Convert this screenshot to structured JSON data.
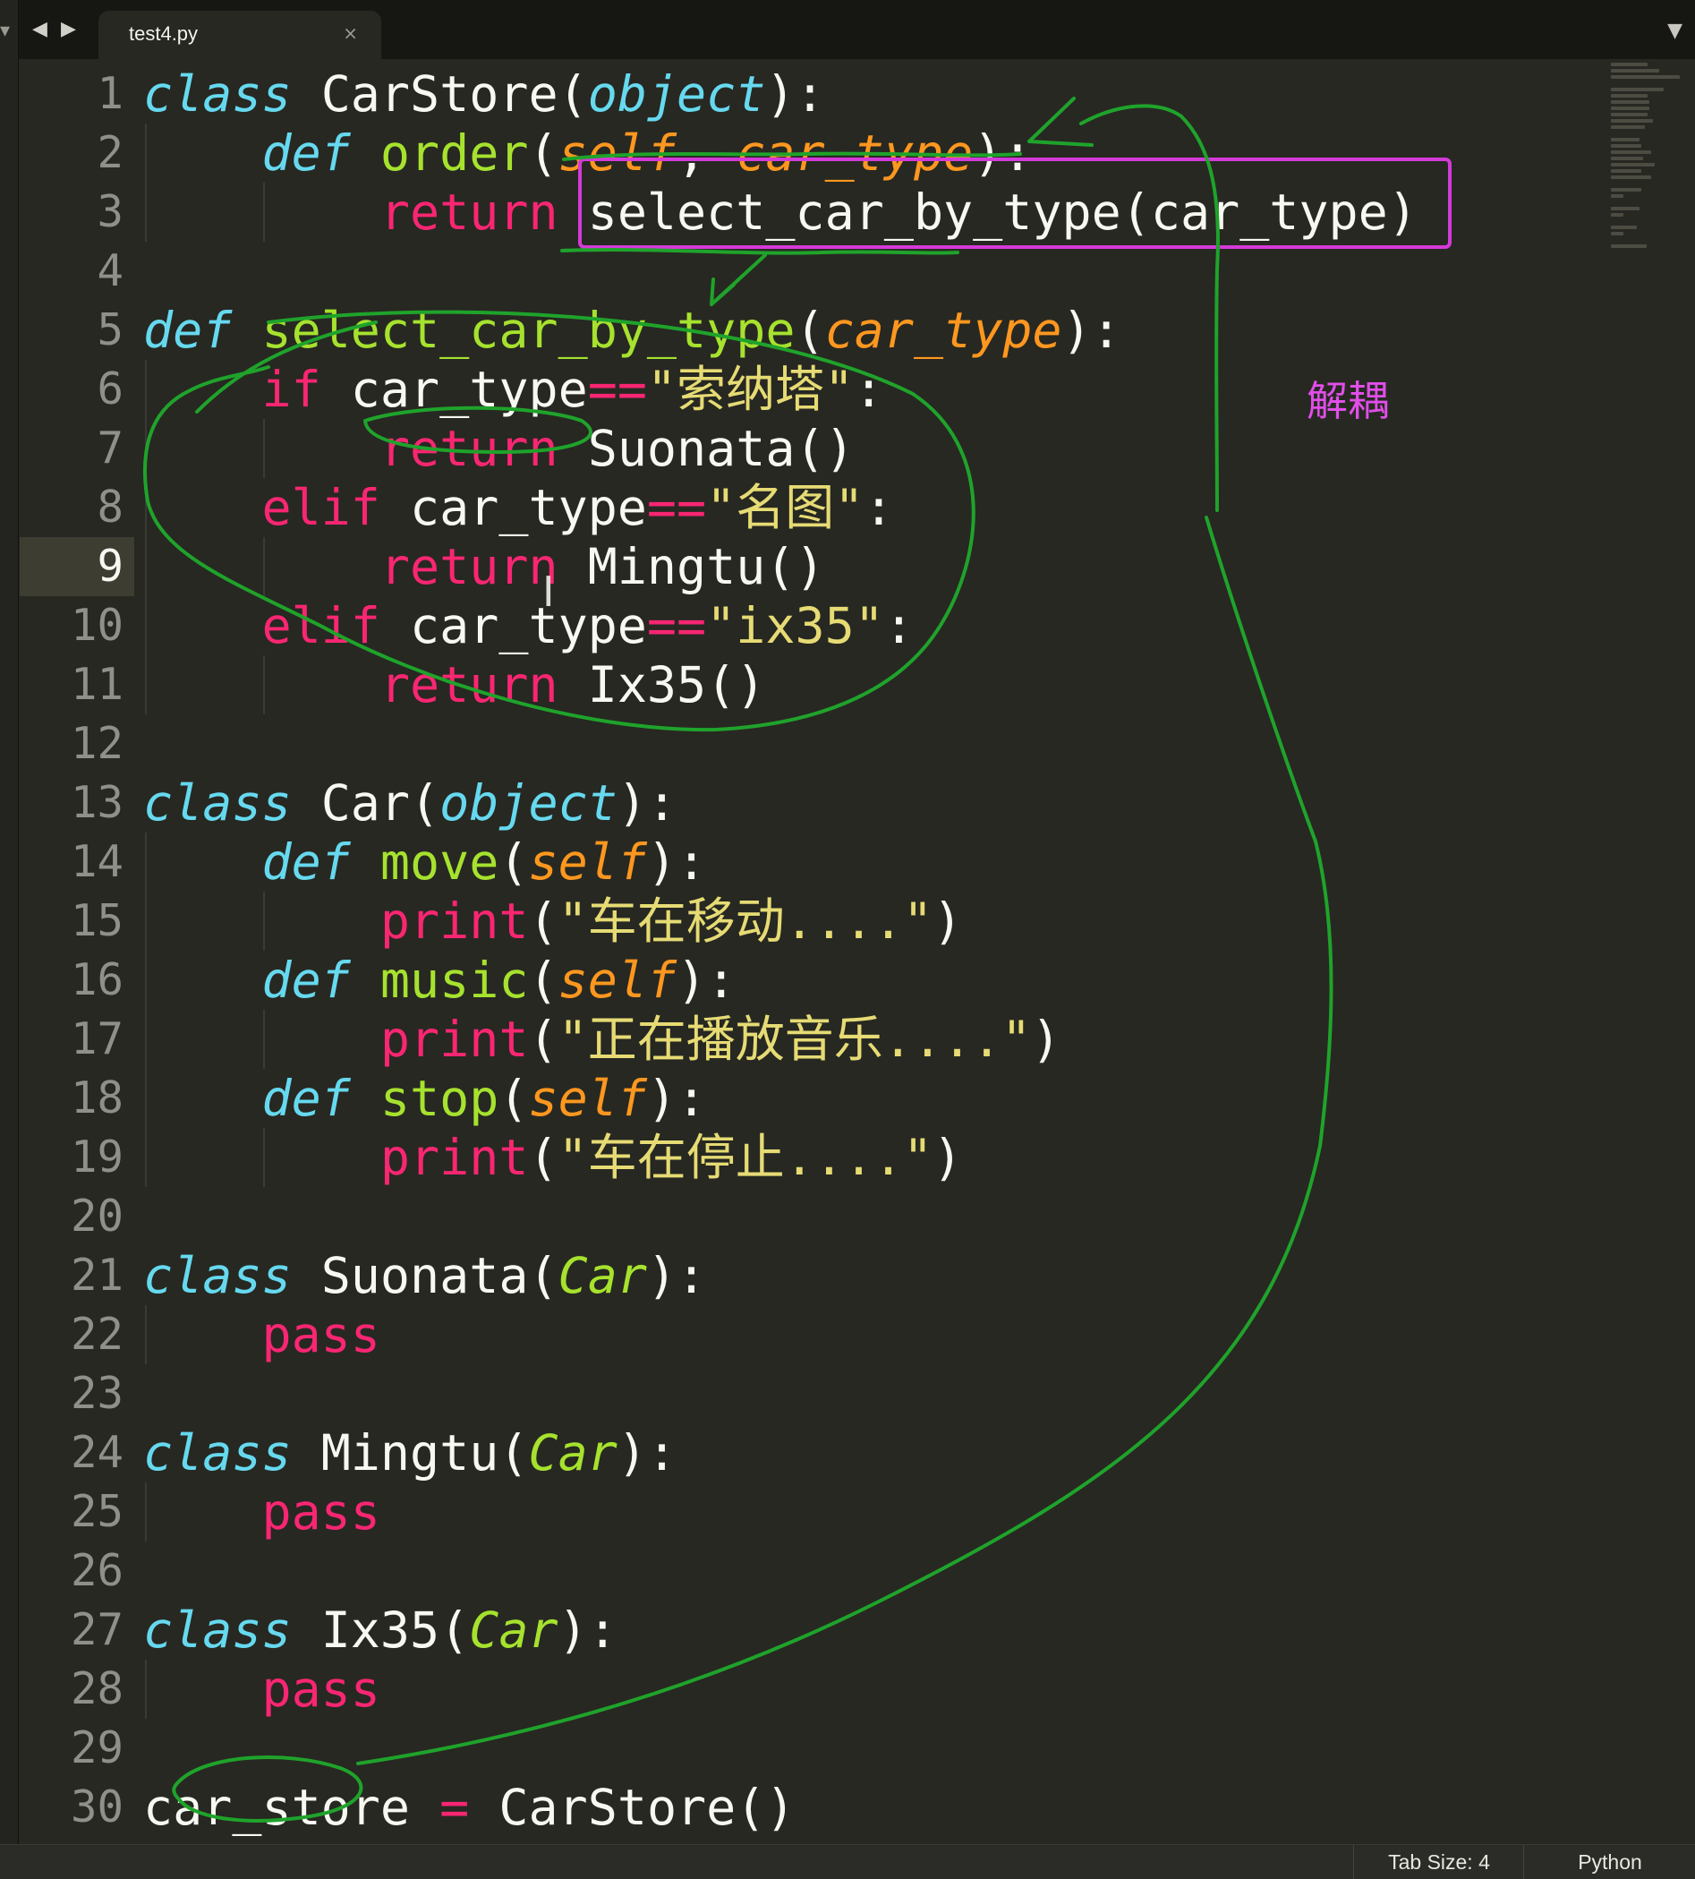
{
  "editor": {
    "tab": {
      "title": "test4.py",
      "close_glyph": "×"
    },
    "icons": {
      "nav_back": "◀",
      "nav_forward": "▶",
      "overflow": "▼",
      "side": "▾",
      "close": "close-icon",
      "text_cursor": "I"
    },
    "current_line": 9,
    "line_numbers": [
      "1",
      "2",
      "3",
      "4",
      "5",
      "6",
      "7",
      "8",
      "9",
      "10",
      "11",
      "12",
      "13",
      "14",
      "15",
      "16",
      "17",
      "18",
      "19",
      "20",
      "21",
      "22",
      "23",
      "24",
      "25",
      "26",
      "27",
      "28",
      "29",
      "30"
    ],
    "lines": [
      [
        {
          "t": "class",
          "c": "kw-i"
        },
        {
          "t": " CarStore("
        },
        {
          "t": "object",
          "c": "bi"
        },
        {
          "t": "):"
        }
      ],
      [
        {
          "t": "    "
        },
        {
          "t": "def",
          "c": "kw-i"
        },
        {
          "t": " "
        },
        {
          "t": "order",
          "c": "fn"
        },
        {
          "t": "("
        },
        {
          "t": "self",
          "c": "par"
        },
        {
          "t": ", "
        },
        {
          "t": "car_type",
          "c": "par"
        },
        {
          "t": "):"
        }
      ],
      [
        {
          "t": "        "
        },
        {
          "t": "return",
          "c": "kw"
        },
        {
          "t": " select_car_by_type(car_type)"
        }
      ],
      [],
      [
        {
          "t": "def",
          "c": "kw-i"
        },
        {
          "t": " "
        },
        {
          "t": "select_car_by_type",
          "c": "fn"
        },
        {
          "t": "("
        },
        {
          "t": "car_type",
          "c": "par"
        },
        {
          "t": "):"
        }
      ],
      [
        {
          "t": "    "
        },
        {
          "t": "if",
          "c": "kw"
        },
        {
          "t": " car_type"
        },
        {
          "t": "==",
          "c": "op"
        },
        {
          "t": "\"索纳塔\"",
          "c": "str"
        },
        {
          "t": ":"
        }
      ],
      [
        {
          "t": "        "
        },
        {
          "t": "return",
          "c": "kw"
        },
        {
          "t": " Suonata()"
        }
      ],
      [
        {
          "t": "    "
        },
        {
          "t": "elif",
          "c": "kw"
        },
        {
          "t": " car_type"
        },
        {
          "t": "==",
          "c": "op"
        },
        {
          "t": "\"名图\"",
          "c": "str"
        },
        {
          "t": ":"
        }
      ],
      [
        {
          "t": "        "
        },
        {
          "t": "return",
          "c": "kw"
        },
        {
          "t": " Mingtu()"
        }
      ],
      [
        {
          "t": "    "
        },
        {
          "t": "elif",
          "c": "kw"
        },
        {
          "t": " car_type"
        },
        {
          "t": "==",
          "c": "op"
        },
        {
          "t": "\"ix35\"",
          "c": "str"
        },
        {
          "t": ":"
        }
      ],
      [
        {
          "t": "        "
        },
        {
          "t": "return",
          "c": "kw"
        },
        {
          "t": " Ix35()"
        }
      ],
      [],
      [
        {
          "t": "class",
          "c": "kw-i"
        },
        {
          "t": " Car("
        },
        {
          "t": "object",
          "c": "bi"
        },
        {
          "t": "):"
        }
      ],
      [
        {
          "t": "    "
        },
        {
          "t": "def",
          "c": "kw-i"
        },
        {
          "t": " "
        },
        {
          "t": "move",
          "c": "fn"
        },
        {
          "t": "("
        },
        {
          "t": "self",
          "c": "par"
        },
        {
          "t": "):"
        }
      ],
      [
        {
          "t": "        "
        },
        {
          "t": "print",
          "c": "kw"
        },
        {
          "t": "("
        },
        {
          "t": "\"车在移动....\"",
          "c": "str"
        },
        {
          "t": ")"
        }
      ],
      [
        {
          "t": "    "
        },
        {
          "t": "def",
          "c": "kw-i"
        },
        {
          "t": " "
        },
        {
          "t": "music",
          "c": "fn"
        },
        {
          "t": "("
        },
        {
          "t": "self",
          "c": "par"
        },
        {
          "t": "):"
        }
      ],
      [
        {
          "t": "        "
        },
        {
          "t": "print",
          "c": "kw"
        },
        {
          "t": "("
        },
        {
          "t": "\"正在播放音乐....\"",
          "c": "str"
        },
        {
          "t": ")"
        }
      ],
      [
        {
          "t": "    "
        },
        {
          "t": "def",
          "c": "kw-i"
        },
        {
          "t": " "
        },
        {
          "t": "stop",
          "c": "fn"
        },
        {
          "t": "("
        },
        {
          "t": "self",
          "c": "par"
        },
        {
          "t": "):"
        }
      ],
      [
        {
          "t": "        "
        },
        {
          "t": "print",
          "c": "kw"
        },
        {
          "t": "("
        },
        {
          "t": "\"车在停止....\"",
          "c": "str"
        },
        {
          "t": ")"
        }
      ],
      [],
      [
        {
          "t": "class",
          "c": "kw-i"
        },
        {
          "t": " Suonata("
        },
        {
          "t": "Car",
          "c": "inh"
        },
        {
          "t": "):"
        }
      ],
      [
        {
          "t": "    "
        },
        {
          "t": "pass",
          "c": "kw"
        }
      ],
      [],
      [
        {
          "t": "class",
          "c": "kw-i"
        },
        {
          "t": " Mingtu("
        },
        {
          "t": "Car",
          "c": "inh"
        },
        {
          "t": "):"
        }
      ],
      [
        {
          "t": "    "
        },
        {
          "t": "pass",
          "c": "kw"
        }
      ],
      [],
      [
        {
          "t": "class",
          "c": "kw-i"
        },
        {
          "t": " Ix35("
        },
        {
          "t": "Car",
          "c": "inh"
        },
        {
          "t": "):"
        }
      ],
      [
        {
          "t": "    "
        },
        {
          "t": "pass",
          "c": "kw"
        }
      ],
      [],
      [
        {
          "t": "car_store "
        },
        {
          "t": "=",
          "c": "op"
        },
        {
          "t": " CarStore()"
        }
      ]
    ]
  },
  "annotation": {
    "text": "解耦",
    "pen_color": "#1fa32b",
    "box_color": "#d43ad8"
  },
  "statusbar": {
    "tab_size": "Tab Size: 4",
    "syntax": "Python"
  },
  "colors": {
    "background": "#272822",
    "keyword": "#f92672",
    "storage": "#66d9ef",
    "function": "#a6e22e",
    "parameter": "#fd971f",
    "string": "#e6db74"
  }
}
